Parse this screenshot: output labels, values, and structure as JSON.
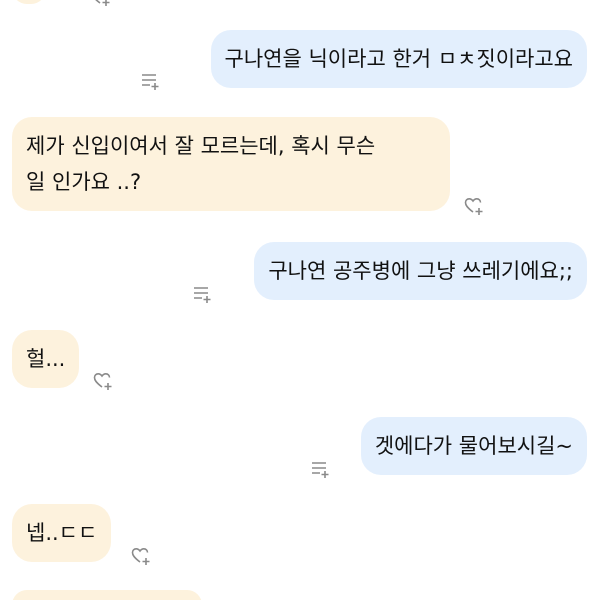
{
  "conversation": {
    "messages": [
      {
        "id": "m1",
        "sender": "me",
        "text": "구나연을 닉이라고 한거 ㅁㅊ짓이라고요",
        "action_icon": "reply-list-icon"
      },
      {
        "id": "m2",
        "sender": "other",
        "text": "제가 신입이여서 잘 모르는데, 혹시 무슨\n일 인가요 ..?",
        "action_icon": "heart-plus-icon"
      },
      {
        "id": "m3",
        "sender": "me",
        "text": "구나연 공주병에 그냥 쓰레기에요;;",
        "action_icon": "reply-list-icon"
      },
      {
        "id": "m4",
        "sender": "other",
        "text": "헐...",
        "action_icon": "heart-plus-icon"
      },
      {
        "id": "m5",
        "sender": "me",
        "text": "겟에다가 물어보시길~",
        "action_icon": "reply-list-icon"
      },
      {
        "id": "m6",
        "sender": "other",
        "text": "넵..ㄷㄷ",
        "action_icon": "heart-plus-icon"
      }
    ]
  },
  "colors": {
    "outgoing_bubble": "#e3effd",
    "incoming_bubble": "#fdf2dd",
    "text": "#111111",
    "icon": "#8a8a8a"
  }
}
